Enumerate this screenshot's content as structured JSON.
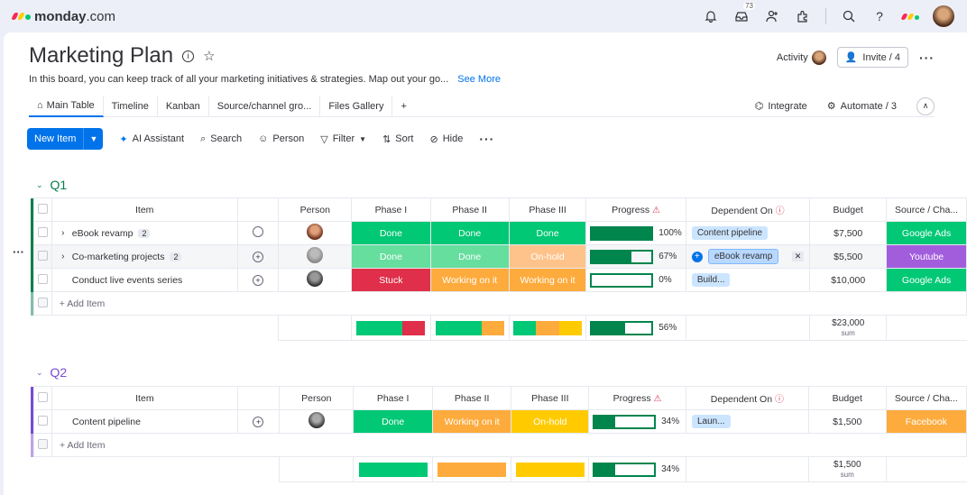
{
  "brand": {
    "name": "monday",
    "suffix": ".com"
  },
  "top": {
    "notif_count": "73"
  },
  "board": {
    "title": "Marketing Plan",
    "description": "In this board, you can keep track of all your marketing initiatives & strategies. Map out your go...",
    "see_more": "See More",
    "activity": "Activity",
    "invite": "Invite / 4"
  },
  "tabs": [
    "Main Table",
    "Timeline",
    "Kanban",
    "Source/channel gro...",
    "Files Gallery",
    "+"
  ],
  "tab_actions": {
    "integrate": "Integrate",
    "automate": "Automate / 3"
  },
  "toolbar": {
    "new_item": "New Item",
    "ai": "AI Assistant",
    "search": "Search",
    "person": "Person",
    "filter": "Filter",
    "sort": "Sort",
    "hide": "Hide"
  },
  "columns": {
    "item": "Item",
    "person": "Person",
    "phase1": "Phase I",
    "phase2": "Phase II",
    "phase3": "Phase III",
    "progress": "Progress",
    "dependent": "Dependent On",
    "budget": "Budget",
    "source": "Source / Cha..."
  },
  "colors": {
    "done": "#00c875",
    "stuck": "#df2f4a",
    "working": "#fdab3d",
    "onhold": "#ffcb00",
    "google": "#00c875",
    "youtube": "#a25ddc",
    "facebook": "#fdab3d",
    "q1": "#037f4c",
    "q2": "#784bd1"
  },
  "groups": [
    {
      "name": "Q1",
      "rows": [
        {
          "item": "eBook revamp",
          "count": "2",
          "p1": "Done",
          "p2": "Done",
          "p3": "Done",
          "progress": 100,
          "progress_label": "100%",
          "dep": "Content pipeline",
          "budget": "$7,500",
          "source": "Google Ads"
        },
        {
          "item": "Co-marketing projects",
          "count": "2",
          "p1": "Done",
          "p2": "Done",
          "p3": "On-hold",
          "progress": 67,
          "progress_label": "67%",
          "dep": "eBook revamp",
          "budget": "$5,500",
          "source": "Youtube"
        },
        {
          "item": "Conduct live events series",
          "count": "",
          "p1": "Stuck",
          "p2": "Working on it",
          "p3": "Working on it",
          "progress": 0,
          "progress_label": "0%",
          "dep": "Build...",
          "budget": "$10,000",
          "source": "Google Ads"
        }
      ],
      "add_item": "+ Add Item",
      "summary": {
        "progress": 56,
        "progress_label": "56%",
        "budget": "$23,000",
        "budget_sub": "sum"
      }
    },
    {
      "name": "Q2",
      "rows": [
        {
          "item": "Content pipeline",
          "count": "",
          "p1": "Done",
          "p2": "Working on it",
          "p3": "On-hold",
          "progress": 34,
          "progress_label": "34%",
          "dep": "Laun...",
          "budget": "$1,500",
          "source": "Facebook"
        }
      ],
      "add_item": "+ Add Item",
      "summary": {
        "progress": 34,
        "progress_label": "34%",
        "budget": "$1,500",
        "budget_sub": "sum"
      }
    }
  ]
}
